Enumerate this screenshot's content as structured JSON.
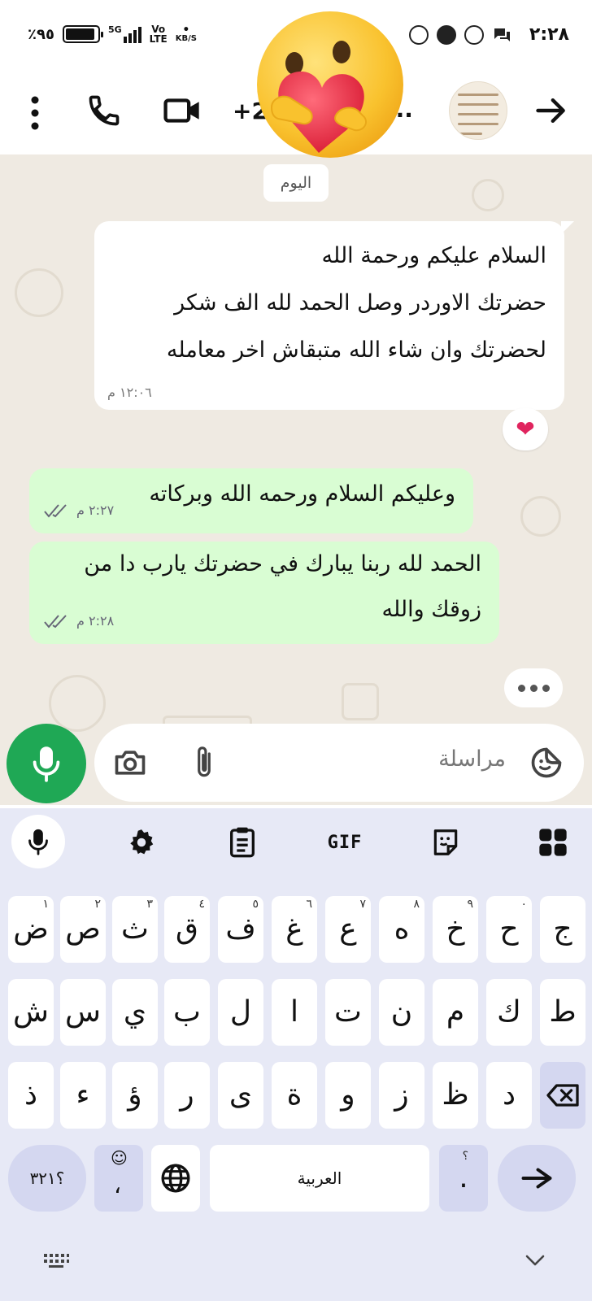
{
  "status_bar": {
    "time": "٢:٢٨",
    "battery": "٪٩٥",
    "battery_level": 0.95,
    "network_type": "5G",
    "volte_top": "Vo",
    "volte_bottom": "LTE",
    "speed_unit": "KB/S",
    "notification_icons": [
      "messenger-icon",
      "messenger-icon",
      "shazam-icon",
      "chat-bubbles-icon"
    ]
  },
  "header": {
    "contact_name": "+2",
    "contact_truncated": "...",
    "icons": [
      "more-vert-icon",
      "phone-icon",
      "video-icon",
      "arrow-forward-icon"
    ]
  },
  "chat": {
    "date_label": "اليوم",
    "incoming": {
      "lines": [
        "السلام عليكم ورحمة الله",
        "حضرتك الاوردر وصل الحمد لله الف شكر",
        "لحضرتك وان شاء الله متبقاش اخر معامله"
      ],
      "time": "١٢:٠٦ م",
      "reaction": "❤️"
    },
    "outgoing": [
      {
        "lines": [
          "وعليكم السلام ورحمه الله وبركاته"
        ],
        "time": "٢:٢٧ م"
      },
      {
        "lines": [
          "الحمد لله ربنا يبارك في حضرتك يارب دا من",
          "زوقك والله"
        ],
        "time": "٢:٢٨ م"
      }
    ]
  },
  "composer": {
    "placeholder": "مراسلة",
    "icons": [
      "mic-icon",
      "camera-icon",
      "attach-icon",
      "sticker-icon"
    ]
  },
  "keyboard": {
    "toolbar": [
      "mic-icon",
      "gear-icon",
      "clipboard-icon",
      "GIF",
      "sticker-icon",
      "apps-grid-icon"
    ],
    "rows": [
      [
        {
          "label": "ج",
          "hint": ""
        },
        {
          "label": "ح",
          "hint": "٠"
        },
        {
          "label": "خ",
          "hint": "٩"
        },
        {
          "label": "ه",
          "hint": "٨"
        },
        {
          "label": "ع",
          "hint": "٧"
        },
        {
          "label": "غ",
          "hint": "٦"
        },
        {
          "label": "ف",
          "hint": "٥"
        },
        {
          "label": "ق",
          "hint": "٤"
        },
        {
          "label": "ث",
          "hint": "٣"
        },
        {
          "label": "ص",
          "hint": "٢"
        },
        {
          "label": "ض",
          "hint": "١"
        }
      ],
      [
        {
          "label": "ط",
          "hint": ""
        },
        {
          "label": "ك",
          "hint": ""
        },
        {
          "label": "م",
          "hint": ""
        },
        {
          "label": "ن",
          "hint": ""
        },
        {
          "label": "ت",
          "hint": ""
        },
        {
          "label": "ا",
          "hint": ""
        },
        {
          "label": "ل",
          "hint": ""
        },
        {
          "label": "ب",
          "hint": ""
        },
        {
          "label": "ي",
          "hint": ""
        },
        {
          "label": "س",
          "hint": ""
        },
        {
          "label": "ش",
          "hint": ""
        }
      ],
      [
        {
          "label": "",
          "hint": ""
        },
        {
          "label": "د",
          "hint": ""
        },
        {
          "label": "ظ",
          "hint": ""
        },
        {
          "label": "ز",
          "hint": ""
        },
        {
          "label": "و",
          "hint": ""
        },
        {
          "label": "ة",
          "hint": ""
        },
        {
          "label": "ى",
          "hint": ""
        },
        {
          "label": "ر",
          "hint": ""
        },
        {
          "label": "ؤ",
          "hint": ""
        },
        {
          "label": "ء",
          "hint": ""
        },
        {
          "label": "ذ",
          "hint": ""
        }
      ]
    ],
    "bottom_row": {
      "symbols": "؟٣٢١",
      "emoji_comma": "،",
      "space_label": "العربية",
      "period": ".",
      "period_hint": "؟"
    }
  },
  "nav": {
    "icons": [
      "keyboard-icon",
      "chevron-down-icon"
    ]
  },
  "colors": {
    "chat_bg": "#efeae2",
    "outgoing_bubble": "#d9fdd3",
    "mic_green": "#1fa855",
    "keyboard_bg": "#e7e9f6",
    "tick_color": "#667"
  }
}
